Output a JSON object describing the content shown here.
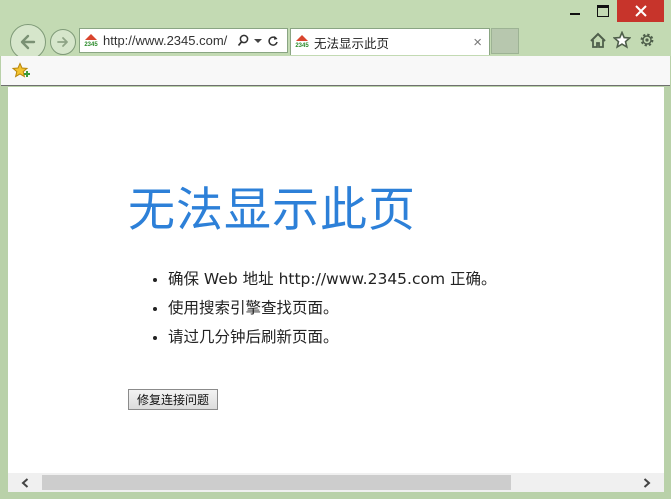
{
  "window": {
    "minimize_icon": "minimize-icon",
    "maximize_icon": "maximize-icon",
    "close_icon": "close-icon",
    "close_color": "#c7342b"
  },
  "nav": {
    "back_icon": "back-arrow-icon",
    "forward_icon": "forward-arrow-icon"
  },
  "address_bar": {
    "url": "http://www.2345.com/",
    "site_logo_text": "2345",
    "search_icon": "search-icon",
    "dropdown_icon": "chevron-down-icon",
    "refresh_icon": "refresh-icon"
  },
  "tab": {
    "title": "无法显示此页",
    "close_label": "×"
  },
  "toolbar": {
    "home_icon": "home-icon",
    "favorites_icon": "star-icon",
    "settings_icon": "gear-icon",
    "add_favorite_icon": "add-favorites-icon"
  },
  "page": {
    "heading": "无法显示此页",
    "heading_color": "#2d80d8",
    "tips": [
      "确保 Web 地址 http://www.2345.com 正确。",
      "使用搜索引擎查找页面。",
      "请过几分钟后刷新页面。"
    ],
    "fix_button_label": "修复连接问题"
  },
  "scrollbar": {
    "left_icon": "scroll-left-icon",
    "right_icon": "scroll-right-icon"
  }
}
